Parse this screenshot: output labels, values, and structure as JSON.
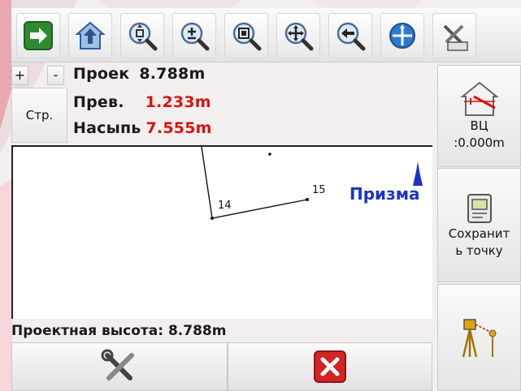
{
  "toolbar": {
    "buttons": [
      {
        "icon": "arrow-right-icon",
        "color": "#2f8a2f"
      },
      {
        "icon": "home-up-icon",
        "color": "#3d6bb3"
      },
      {
        "icon": "zoom-center-icon",
        "color": "#3d6bb3"
      },
      {
        "icon": "zoom-in-icon",
        "color": "#3d6bb3"
      },
      {
        "icon": "zoom-window-icon",
        "color": "#3d6bb3"
      },
      {
        "icon": "pan-icon",
        "color": "#3d6bb3"
      },
      {
        "icon": "zoom-back-icon",
        "color": "#3d6bb3"
      },
      {
        "icon": "compass-icon",
        "color": "#2a7bd1"
      },
      {
        "icon": "tools-icon",
        "color": "#555555"
      }
    ]
  },
  "controls": {
    "plus_label": "+",
    "minus_label": "-",
    "page_label": "Стр."
  },
  "info": {
    "design": {
      "label": "Проек",
      "value": "8.788m"
    },
    "elevation": {
      "label": "Прев.",
      "value": "1.233m"
    },
    "fill": {
      "label": "Насыпь",
      "value": "7.555m"
    }
  },
  "map": {
    "points": [
      {
        "label": "14"
      },
      {
        "label": "15"
      }
    ],
    "prism_label": "Призма"
  },
  "status": {
    "text": "Проектная высота: 8.788m"
  },
  "side": {
    "instrument_height_label": "ВЦ",
    "instrument_height_value": ":0.000m",
    "save_point_label_1": "Сохранит",
    "save_point_label_2": "ь точку"
  },
  "colors": {
    "accent_red": "#d8130f",
    "prism_blue": "#1c33c8"
  }
}
